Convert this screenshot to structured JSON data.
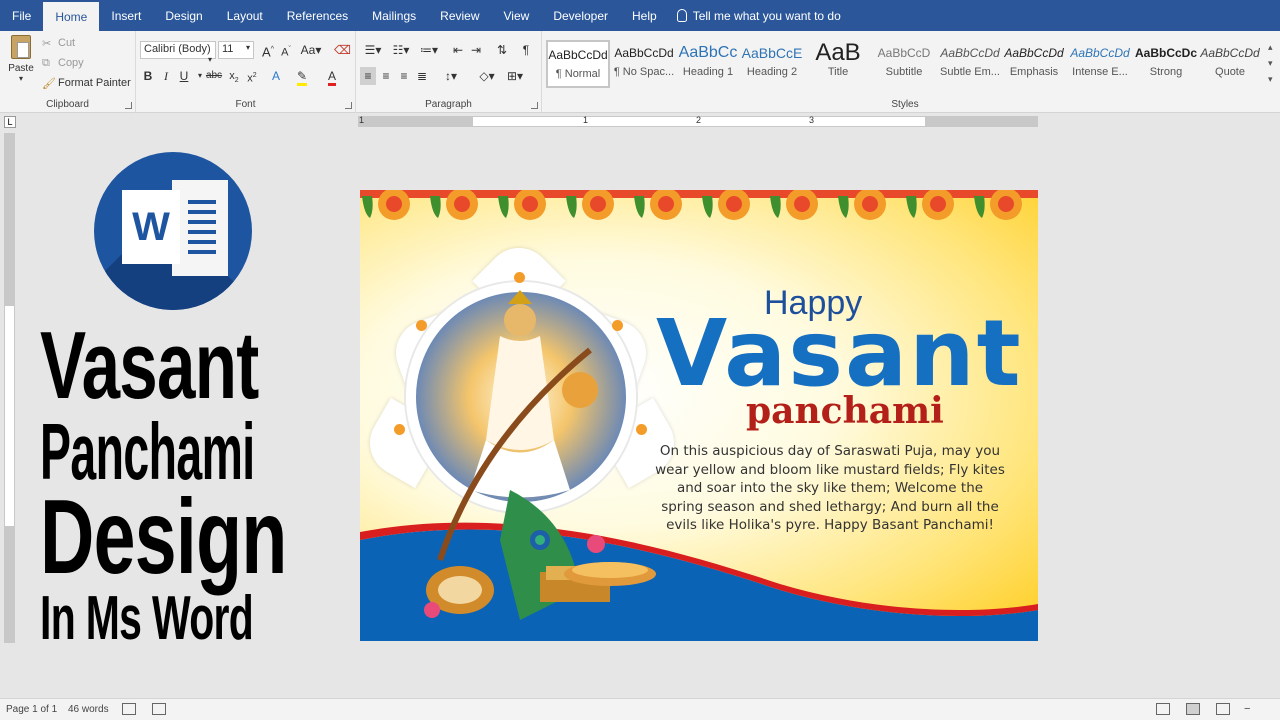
{
  "tabs": [
    "File",
    "Home",
    "Insert",
    "Design",
    "Layout",
    "References",
    "Mailings",
    "Review",
    "View",
    "Developer",
    "Help"
  ],
  "active_tab": "Home",
  "tell_me": "Tell me what you want to do",
  "clipboard": {
    "paste": "Paste",
    "cut": "Cut",
    "copy": "Copy",
    "format_painter": "Format Painter",
    "label": "Clipboard"
  },
  "font": {
    "name": "Calibri (Body)",
    "size": "11",
    "label": "Font"
  },
  "paragraph": {
    "label": "Paragraph"
  },
  "styles": {
    "label": "Styles",
    "items": [
      {
        "sample": "AaBbCcDd",
        "name": "¶ Normal"
      },
      {
        "sample": "AaBbCcDd",
        "name": "¶ No Spac..."
      },
      {
        "sample": "AaBbCc",
        "name": "Heading 1"
      },
      {
        "sample": "AaBbCcE",
        "name": "Heading 2"
      },
      {
        "sample": "AaB",
        "name": "Title"
      },
      {
        "sample": "AaBbCcD",
        "name": "Subtitle"
      },
      {
        "sample": "AaBbCcDd",
        "name": "Subtle Em..."
      },
      {
        "sample": "AaBbCcDd",
        "name": "Emphasis"
      },
      {
        "sample": "AaBbCcDd",
        "name": "Intense E..."
      },
      {
        "sample": "AaBbCcDc",
        "name": "Strong"
      },
      {
        "sample": "AaBbCcDd",
        "name": "Quote"
      }
    ]
  },
  "ruler": {
    "numbers": [
      "1",
      "1",
      "2",
      "3"
    ]
  },
  "headline": {
    "line1": "Vasant",
    "line2": "Panchami",
    "line3": "Design",
    "line4": "In Ms Word"
  },
  "word_logo_letter": "W",
  "card": {
    "happy": "Happy",
    "vasant": "Vasant",
    "panchami": "panchami",
    "message": "On this auspicious day of Saraswati Puja, may you wear yellow and bloom like mustard fields; Fly kites and soar into the sky like them; Welcome the spring season and shed lethargy; And burn all the evils like Holika's pyre. Happy Basant Panchami!"
  },
  "status": {
    "page": "Page 1 of 1",
    "words": "46 words"
  },
  "colors": {
    "ribbon_blue": "#2b579a",
    "card_blue": "#1670c2",
    "card_red": "#b3201a",
    "marigold": "#f39c2a"
  }
}
